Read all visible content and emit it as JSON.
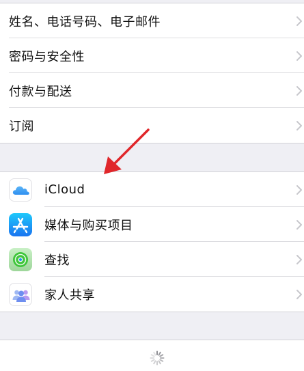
{
  "account_settings": {
    "items": [
      {
        "label": "姓名、电话号码、电子邮件"
      },
      {
        "label": "密码与安全性"
      },
      {
        "label": "付款与配送"
      },
      {
        "label": "订阅"
      }
    ]
  },
  "services": {
    "items": [
      {
        "label": "iCloud",
        "icon": "icloud-icon"
      },
      {
        "label": "媒体与购买项目",
        "icon": "app-store-icon"
      },
      {
        "label": "查找",
        "icon": "find-my-icon"
      },
      {
        "label": "家人共享",
        "icon": "family-sharing-icon"
      }
    ]
  },
  "colors": {
    "annotation_arrow": "#e0272b",
    "chevron": "#c7c7cc",
    "group_background": "#efeff4"
  }
}
